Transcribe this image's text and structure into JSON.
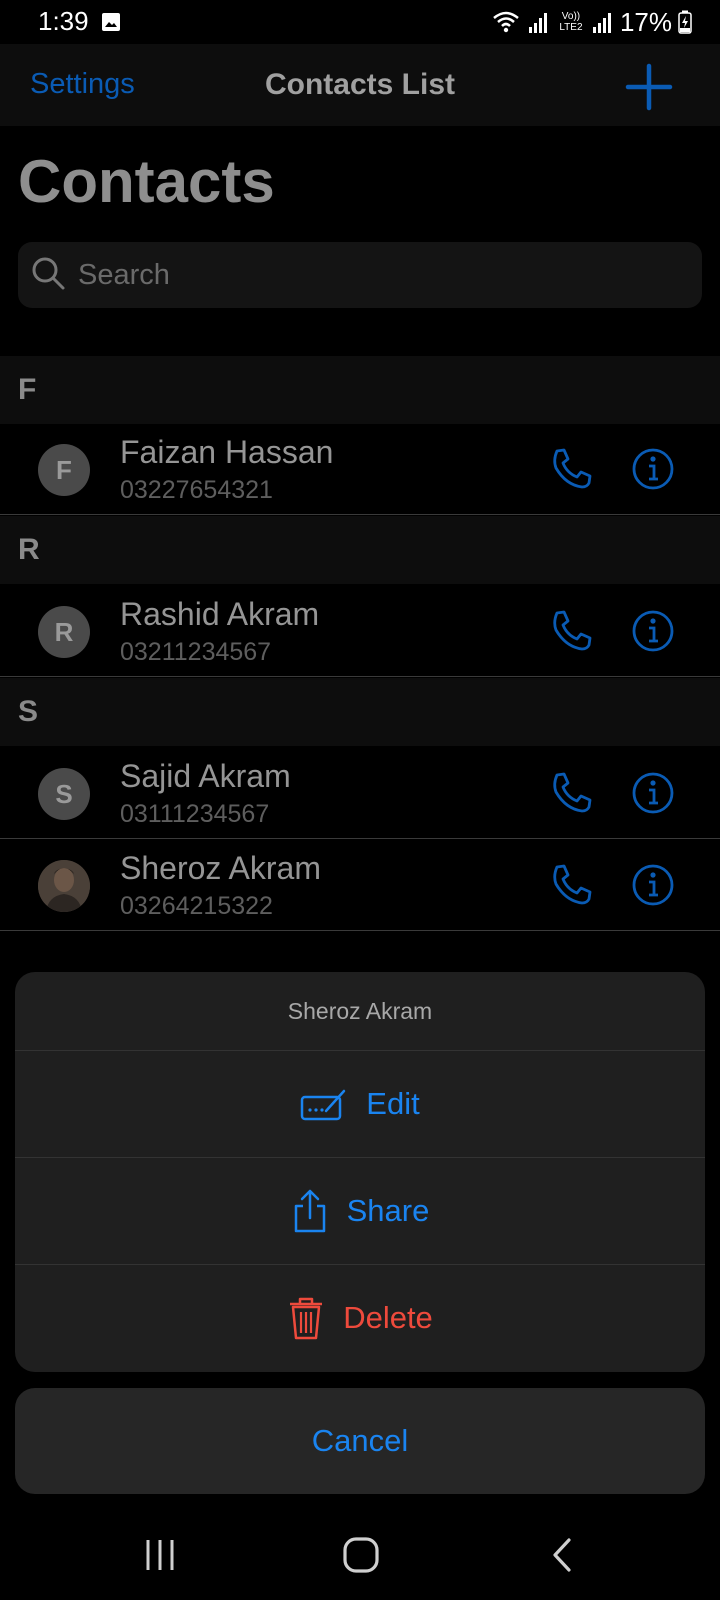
{
  "status_bar": {
    "time": "1:39",
    "battery": "17%",
    "network_label": "Vo)) LTE2"
  },
  "nav": {
    "settings_label": "Settings",
    "title": "Contacts List",
    "add_icon": "plus-icon"
  },
  "page": {
    "title": "Contacts"
  },
  "search": {
    "placeholder": "Search"
  },
  "sections": [
    {
      "letter": "F",
      "contacts": [
        {
          "initial": "F",
          "name": "Faizan Hassan",
          "phone": "03227654321"
        }
      ]
    },
    {
      "letter": "R",
      "contacts": [
        {
          "initial": "R",
          "name": "Rashid Akram",
          "phone": "03211234567"
        }
      ]
    },
    {
      "letter": "S",
      "contacts": [
        {
          "initial": "S",
          "name": "Sajid Akram",
          "phone": "03111234567"
        },
        {
          "initial": "",
          "name": "Sheroz Akram",
          "phone": "03264215322",
          "avatar": "photo"
        }
      ]
    }
  ],
  "action_sheet": {
    "title": "Sheroz Akram",
    "edit_label": "Edit",
    "share_label": "Share",
    "delete_label": "Delete",
    "cancel_label": "Cancel"
  },
  "colors": {
    "accent": "#1a84f0",
    "nav_accent": "#0a5bb4",
    "destructive": "#ee4a3c",
    "background": "#000000"
  }
}
